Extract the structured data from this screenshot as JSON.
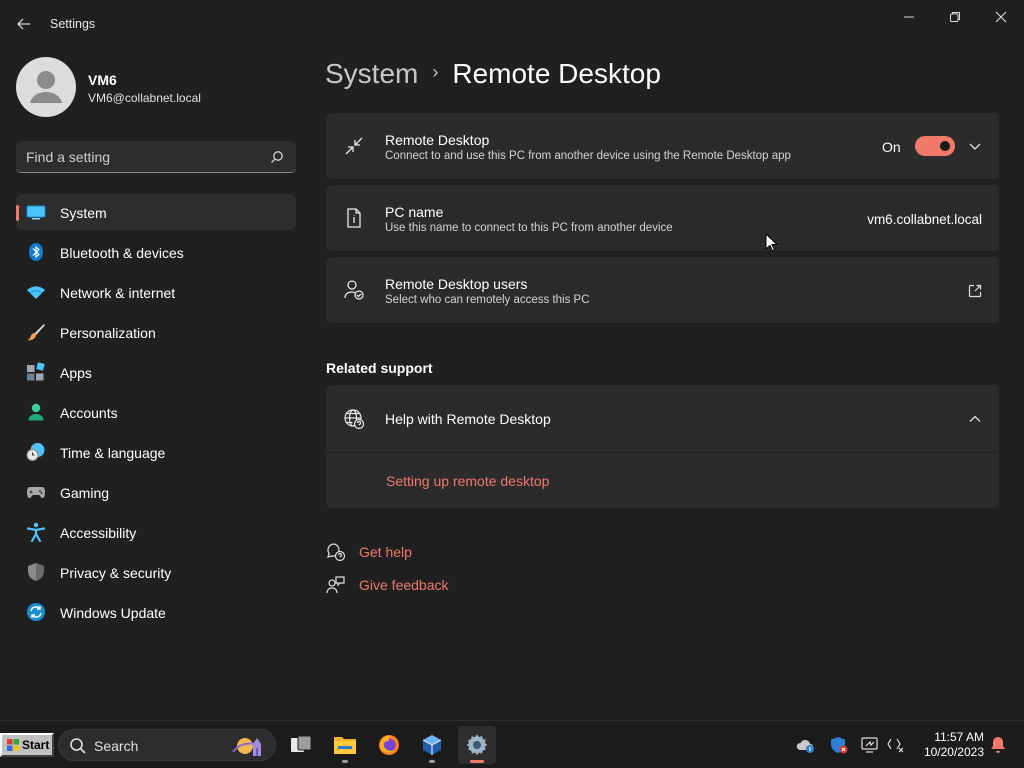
{
  "window": {
    "title": "Settings"
  },
  "user": {
    "name": "VM6",
    "email": "VM6@collabnet.local"
  },
  "search": {
    "placeholder": "Find a setting"
  },
  "nav": [
    {
      "label": "System",
      "icon": "system-display-icon",
      "selected": true
    },
    {
      "label": "Bluetooth & devices",
      "icon": "bluetooth-icon"
    },
    {
      "label": "Network & internet",
      "icon": "wifi-icon"
    },
    {
      "label": "Personalization",
      "icon": "brush-icon"
    },
    {
      "label": "Apps",
      "icon": "apps-icon"
    },
    {
      "label": "Accounts",
      "icon": "person-icon"
    },
    {
      "label": "Time & language",
      "icon": "clock-globe-icon"
    },
    {
      "label": "Gaming",
      "icon": "gamepad-icon"
    },
    {
      "label": "Accessibility",
      "icon": "accessibility-icon"
    },
    {
      "label": "Privacy & security",
      "icon": "shield-icon"
    },
    {
      "label": "Windows Update",
      "icon": "update-icon"
    }
  ],
  "breadcrumb": {
    "parent": "System",
    "current": "Remote Desktop"
  },
  "cards": {
    "remote_desktop": {
      "title": "Remote Desktop",
      "subtitle": "Connect to and use this PC from another device using the Remote Desktop app",
      "state_label": "On",
      "enabled": true
    },
    "pc_name": {
      "title": "PC name",
      "subtitle": "Use this name to connect to this PC from another device",
      "value": "vm6.collabnet.local"
    },
    "users": {
      "title": "Remote Desktop users",
      "subtitle": "Select who can remotely access this PC"
    }
  },
  "related": {
    "heading": "Related support",
    "help_title": "Help with Remote Desktop",
    "help_link": "Setting up remote desktop"
  },
  "footer": {
    "get_help": "Get help",
    "give_feedback": "Give feedback"
  },
  "taskbar": {
    "start_label": "Start",
    "search_label": "Search",
    "time": "11:57 AM",
    "date": "10/20/2023"
  },
  "colors": {
    "accent": "#f0796a",
    "background": "#202020",
    "card": "#2b2b2b"
  }
}
